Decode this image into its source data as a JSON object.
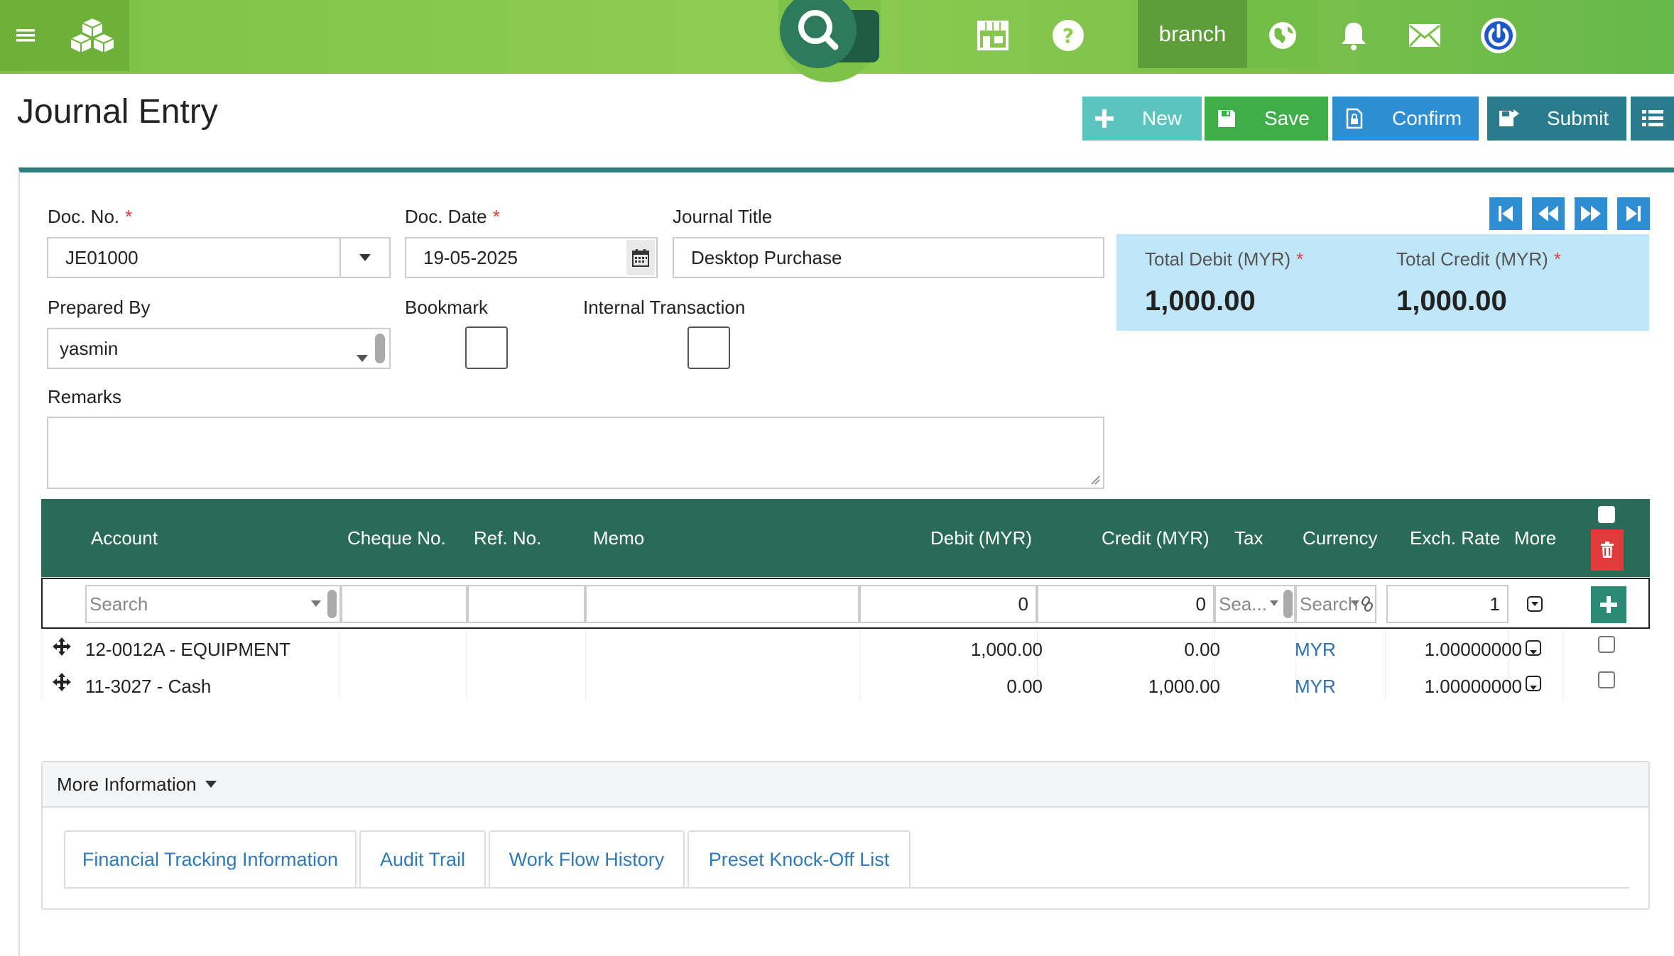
{
  "topbar": {
    "branch_label": "branch",
    "colors": {
      "bar": "#8fcc52",
      "search": "#2e7a5c",
      "power": "#1c58c7"
    }
  },
  "page": {
    "title": "Journal Entry"
  },
  "actions": {
    "new": "New",
    "save": "Save",
    "confirm": "Confirm",
    "submit": "Submit"
  },
  "form": {
    "doc_no": {
      "label": "Doc. No.",
      "value": "JE01000"
    },
    "doc_date": {
      "label": "Doc. Date",
      "value": "19-05-2025"
    },
    "journal_title": {
      "label": "Journal Title",
      "value": "Desktop Purchase"
    },
    "prepared_by": {
      "label": "Prepared By",
      "value": "yasmin"
    },
    "bookmark": {
      "label": "Bookmark"
    },
    "internal_transaction": {
      "label": "Internal Transaction"
    },
    "remarks": {
      "label": "Remarks",
      "value": ""
    },
    "required_mark": "*"
  },
  "totals": {
    "debit_label": "Total Debit (MYR)",
    "debit_value": "1,000.00",
    "credit_label": "Total Credit (MYR)",
    "credit_value": "1,000.00"
  },
  "grid": {
    "columns": [
      "Account",
      "Cheque No.",
      "Ref. No.",
      "Memo",
      "Debit (MYR)",
      "Credit (MYR)",
      "Tax",
      "Currency",
      "Exch. Rate",
      "More"
    ],
    "entry": {
      "account_placeholder": "Search",
      "debit": "0",
      "credit": "0",
      "tax_placeholder": "Sea...",
      "currency_placeholder": "Search",
      "exch_rate": "1"
    },
    "rows": [
      {
        "account": "12-0012A - EQUIPMENT",
        "debit": "1,000.00",
        "credit": "0.00",
        "currency": "MYR",
        "exch_rate": "1.00000000"
      },
      {
        "account": "11-3027 - Cash",
        "debit": "0.00",
        "credit": "1,000.00",
        "currency": "MYR",
        "exch_rate": "1.00000000"
      }
    ]
  },
  "more_info": {
    "title": "More Information",
    "tabs": [
      "Financial Tracking Information",
      "Audit Trail",
      "Work Flow History",
      "Preset Knock-Off List"
    ]
  }
}
